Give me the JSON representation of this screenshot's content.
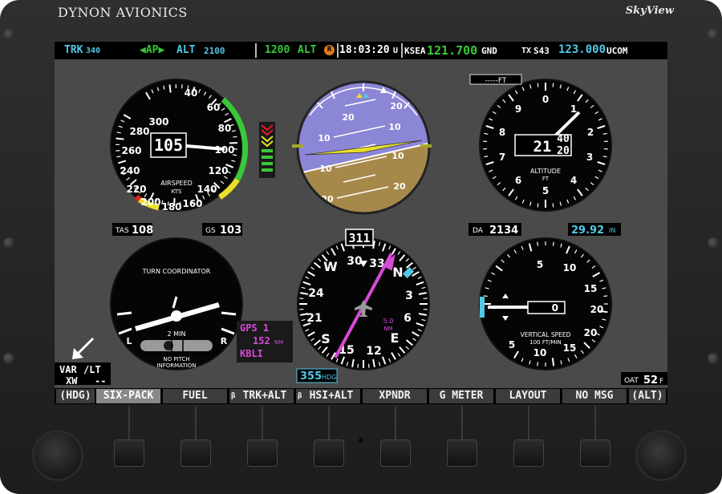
{
  "brand": "DYNON AVIONICS",
  "model": "SkyView",
  "topbar": {
    "trk": "TRK",
    "trk_value": "340",
    "ap": "◀AP▶",
    "alt_mode": "ALT",
    "alt_target": "2100",
    "alt_bug": "1200",
    "alt_bug_label": "ALT",
    "alert_icon": "R",
    "time": "18:03:20",
    "time_suffix": "U",
    "com_station": "KSEA",
    "com_freq": "121.700",
    "com_label": "GND",
    "tx": "TX",
    "xpdr": "S43",
    "com2_freq": "123.000",
    "com2_label": "UCOM"
  },
  "airspeed": {
    "value": "105",
    "title": "AIRSPEED",
    "unit": "KTS",
    "ticks": [
      "40",
      "60",
      "80",
      "100",
      "120",
      "140",
      "160",
      "180",
      "200",
      "220",
      "240",
      "260",
      "280",
      "300"
    ],
    "tas_label": "TAS",
    "tas_value": "108",
    "gs_label": "GS",
    "gs_value": "103"
  },
  "attitude": {
    "pitch_labels": [
      "20",
      "20",
      "10",
      "10",
      "10",
      "10",
      "20",
      "20"
    ]
  },
  "altimeter": {
    "value_main": "21",
    "value_roll_top": "40",
    "value_roll_bottom": "20",
    "title": "ALTITUDE",
    "unit": "FT",
    "ticks": [
      "0",
      "1",
      "2",
      "3",
      "4",
      "5",
      "6",
      "7",
      "8",
      "9"
    ],
    "bug_label": "-----FT",
    "da_label": "DA",
    "da_value": "2134",
    "baro_value": "29.92",
    "baro_unit": "IN"
  },
  "turn_coordinator": {
    "title": "TURN COORDINATOR",
    "rate": "2 MIN",
    "left": "L",
    "right": "R",
    "note_line1": "NO PITCH",
    "note_line2": "INFORMATION"
  },
  "hsi": {
    "heading": "311",
    "heading_bug": "355",
    "heading_bug_unit": "HDG",
    "labels": [
      "W",
      "30",
      "33",
      "N",
      "3",
      "6",
      "E",
      "12",
      "15",
      "S",
      "21",
      "24"
    ],
    "dist": "5.0",
    "dist_unit": "NM"
  },
  "gps": {
    "source": "GPS 1",
    "distance": "152",
    "distance_unit": "NM",
    "waypoint": "KBLI"
  },
  "vsi": {
    "title": "VERTICAL SPEED",
    "unit": "100 FT/MIN",
    "value": "0",
    "labels": [
      "5",
      "10",
      "15",
      "20",
      "20",
      "15",
      "10",
      "5"
    ]
  },
  "wind": {
    "var_label": "VAR",
    "var_value": "/LT",
    "xw_label": "XW",
    "xw_value": "--"
  },
  "oat": {
    "label": "OAT",
    "value": "52",
    "unit": "F"
  },
  "softkeys": [
    "(HDG)",
    "SIX-PACK",
    "FUEL",
    "TRK+ALT",
    "HSI+ALT",
    "XPNDR",
    "G METER",
    "LAYOUT",
    "NO MSG",
    "(ALT)"
  ],
  "softkey_icons": [
    "",
    "",
    "",
    "β",
    "β",
    "",
    "",
    "",
    "",
    ""
  ],
  "colors": {
    "cyan": "#52c8e6",
    "green": "#39c83a",
    "magenta": "#d64bd6",
    "sky": "#8c86d6",
    "ground": "#a6894a",
    "yellow": "#e8e02a"
  }
}
